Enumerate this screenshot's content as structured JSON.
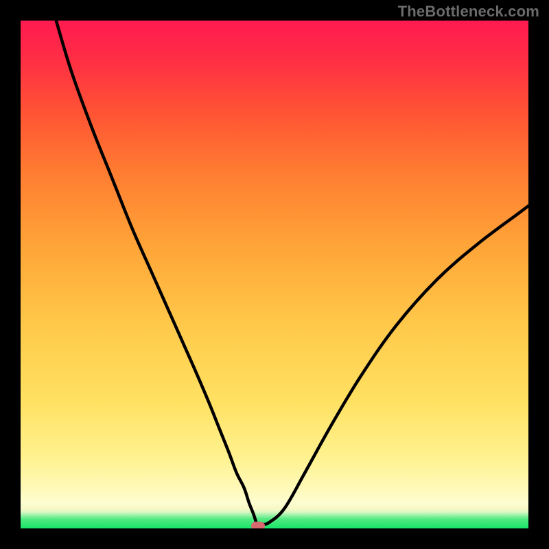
{
  "watermark": "TheBottleneck.com",
  "colors": {
    "background": "#000000",
    "curve_stroke": "#000000",
    "marker": "#d86a6f",
    "gradient_top": "#ff1a50",
    "gradient_bottom": "#19e56a"
  },
  "chart_data": {
    "type": "line",
    "title": "",
    "xlabel": "",
    "ylabel": "",
    "xlim": [
      0,
      100
    ],
    "ylim": [
      0,
      100
    ],
    "grid": false,
    "notes": "Bottleneck-style V curve on rainbow gradient; minimum marked by pill",
    "series": [
      {
        "name": "bottleneck_curve",
        "x": [
          7,
          10,
          14,
          18,
          22,
          26,
          30,
          34,
          37,
          39,
          41,
          42.5,
          44,
          45,
          45.8,
          46.3,
          46.5,
          47.5,
          49,
          52,
          56,
          61,
          67,
          74,
          82,
          90,
          98,
          100
        ],
        "values": [
          100,
          90,
          79,
          69,
          59,
          50,
          41,
          32,
          25,
          20,
          15,
          11,
          8,
          5,
          3,
          1.5,
          0.8,
          0.8,
          1.2,
          4,
          11,
          20,
          30,
          40,
          49,
          56,
          62,
          63.5
        ]
      }
    ],
    "marker": {
      "x": 46.8,
      "y": 0.8
    }
  }
}
